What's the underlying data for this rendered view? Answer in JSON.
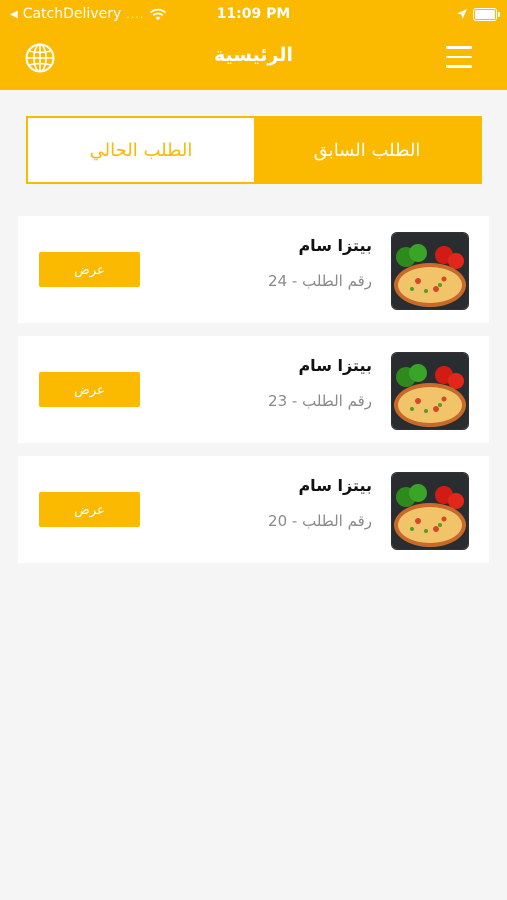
{
  "status_bar": {
    "carrier": "CatchDelivery",
    "signal_dots": "....",
    "time": "11:09 PM"
  },
  "nav": {
    "title": "الرئيسية",
    "globe_icon": "globe-icon",
    "menu_icon": "hamburger-menu-icon"
  },
  "tabs": {
    "current_label": "الطلب الحالي",
    "previous_label": "الطلب السابق",
    "selected": "previous"
  },
  "orders": [
    {
      "name": "بيتزا سام",
      "number": "رقم الطلب - 24",
      "button": "عرض"
    },
    {
      "name": "بيتزا سام",
      "number": "رقم الطلب - 23",
      "button": "عرض"
    },
    {
      "name": "بيتزا سام",
      "number": "رقم الطلب - 20",
      "button": "عرض"
    }
  ],
  "colors": {
    "accent": "#fbb900",
    "background": "#f5f5f5"
  }
}
